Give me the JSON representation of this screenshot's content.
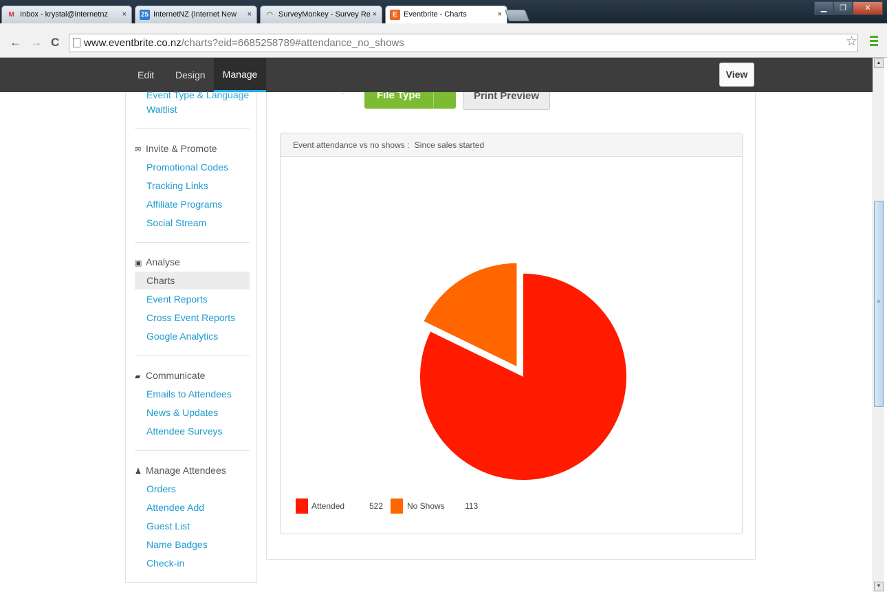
{
  "browser": {
    "tabs": [
      {
        "label": "Inbox - krystal@internetnz",
        "icon": "gmail-icon"
      },
      {
        "label": "InternetNZ (Internet New",
        "icon": "calendar-icon"
      },
      {
        "label": "SurveyMonkey - Survey Re",
        "icon": "surveymonkey-icon"
      },
      {
        "label": "Eventbrite - Charts",
        "icon": "eventbrite-icon",
        "active": true
      }
    ],
    "url_domain": "www.eventbrite.co.nz",
    "url_rest": "/charts?eid=6685258789#attendance_no_shows"
  },
  "topnav": {
    "edit": "Edit",
    "design": "Design",
    "manage": "Manage",
    "view": "View"
  },
  "sidebar": {
    "cut_item": "Event Type & Language",
    "waitlist": "Waitlist",
    "sections": [
      {
        "title": "Invite & Promote",
        "icon": "envelope-icon",
        "items": [
          "Promotional Codes",
          "Tracking Links",
          "Affiliate Programs",
          "Social Stream"
        ]
      },
      {
        "title": "Analyse",
        "icon": "presentation-icon",
        "items": [
          "Charts",
          "Event Reports",
          "Cross Event Reports",
          "Google Analytics"
        ],
        "active": "Charts"
      },
      {
        "title": "Communicate",
        "icon": "chat-icon",
        "items": [
          "Emails to Attendees",
          "News & Updates",
          "Attendee Surveys"
        ]
      },
      {
        "title": "Manage Attendees",
        "icon": "people-icon",
        "items": [
          "Orders",
          "Attendee Add",
          "Guest List",
          "Name Badges",
          "Check-in"
        ]
      }
    ]
  },
  "toolbar": {
    "file_type": "File Type",
    "print_preview": "Print Preview"
  },
  "panel": {
    "title": "Event attendance vs no shows :",
    "range": "Since sales started"
  },
  "colors": {
    "attended": "#ff1a00",
    "no_shows": "#ff6600"
  },
  "chart_data": {
    "type": "pie",
    "categories": [
      "Attended",
      "No Shows"
    ],
    "values": [
      522,
      113
    ],
    "exploded": "No Shows"
  }
}
